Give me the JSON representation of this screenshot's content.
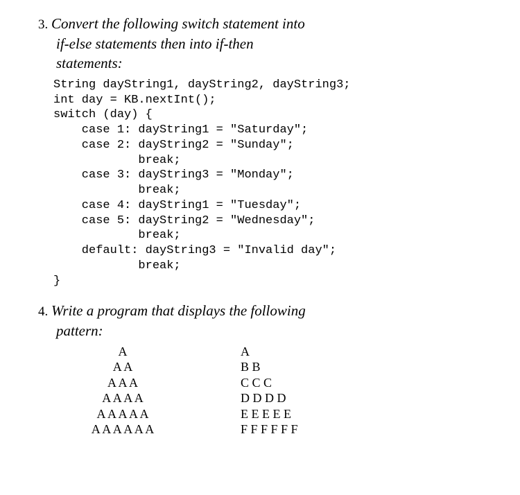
{
  "q3": {
    "num": "3.",
    "prompt_line1": "Convert the following switch statement into",
    "prompt_line2": "if-else statements then into if-then",
    "prompt_line3": "statements:",
    "code": "String dayString1, dayString2, dayString3;\nint day = KB.nextInt();\nswitch (day) {\n    case 1: dayString1 = \"Saturday\";\n    case 2: dayString2 = \"Sunday\";\n            break;\n    case 3: dayString3 = \"Monday\";\n            break;\n    case 4: dayString1 = \"Tuesday\";\n    case 5: dayString2 = \"Wednesday\";\n            break;\n    default: dayString3 = \"Invalid day\";\n            break;\n}"
  },
  "q4": {
    "num": "4.",
    "prompt_line1": "Write a program that displays the following",
    "prompt_line2": "pattern:",
    "left_pattern": "A\nA A\nA A A\nA A A A\nA A A A A\nA A A A A A",
    "right_pattern": "A\nB B\nC C C\nD D D D\nE E E E E\nF F F F F F"
  }
}
